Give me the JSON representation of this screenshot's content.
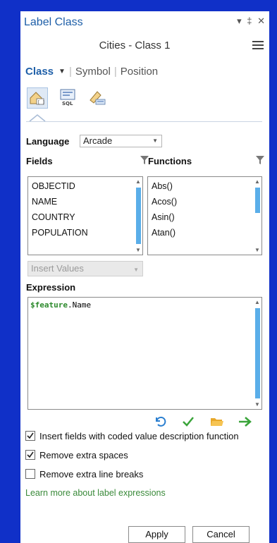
{
  "pane": {
    "title": "Label Class",
    "controls": "▾ ‡ ✕"
  },
  "subtitle": "Cities - Class 1",
  "tabs": {
    "class": "Class",
    "symbol": "Symbol",
    "position": "Position"
  },
  "language": {
    "label": "Language",
    "value": "Arcade"
  },
  "fields": {
    "header": "Fields",
    "items": [
      "OBJECTID",
      "NAME",
      "COUNTRY",
      "POPULATION"
    ]
  },
  "functions": {
    "header": "Functions",
    "items": [
      "Abs()",
      "Acos()",
      "Asin()",
      "Atan()"
    ]
  },
  "insert_values": {
    "value": "Insert Values"
  },
  "expression": {
    "header": "Expression",
    "token_var": "$feature",
    "token_rest": ".Name"
  },
  "options": [
    {
      "label": "Insert fields with coded value description function",
      "checked": true
    },
    {
      "label": "Remove extra spaces",
      "checked": true
    },
    {
      "label": "Remove extra line breaks",
      "checked": false
    }
  ],
  "learn_more": "Learn more about label expressions",
  "buttons": {
    "apply": "Apply",
    "cancel": "Cancel"
  },
  "colors": {
    "accent": "#1e5fa8",
    "scroll_thumb": "#5aaee9",
    "verify": "#3aa43a",
    "folder": "#e8a82a"
  }
}
